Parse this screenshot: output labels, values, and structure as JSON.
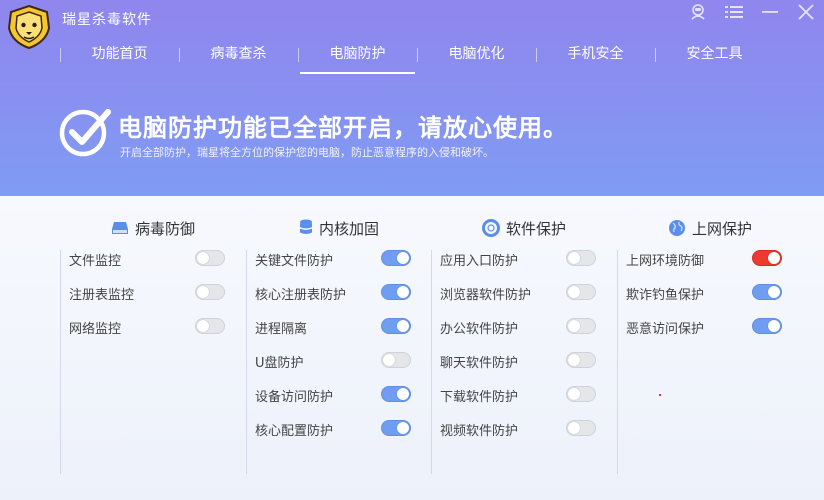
{
  "app": {
    "title": "瑞星杀毒软件",
    "logo_icon": "lion-logo-icon"
  },
  "window_controls": [
    {
      "name": "account-icon"
    },
    {
      "name": "menu-icon"
    },
    {
      "name": "minimize-icon"
    },
    {
      "name": "close-icon"
    }
  ],
  "nav": {
    "items": [
      {
        "label": "功能首页",
        "active": false
      },
      {
        "label": "病毒查杀",
        "active": false
      },
      {
        "label": "电脑防护",
        "active": true
      },
      {
        "label": "电脑优化",
        "active": false
      },
      {
        "label": "手机安全",
        "active": false
      },
      {
        "label": "安全工具",
        "active": false
      }
    ]
  },
  "banner": {
    "title": "电脑防护功能已全部开启，请放心使用。",
    "subtitle": "开启全部防护，瑞星将全方位的保护您的电脑，防止恶意程序的入侵和破坏。"
  },
  "colors": {
    "toggle_on": "#6f9ef0",
    "toggle_on_alert": "#ee3a2e",
    "toggle_off": "#e4e6ea",
    "header_top": "#8f86ee",
    "header_bottom": "#7e9cf3"
  },
  "sections": [
    {
      "title": "病毒防御",
      "icon": "hard-drive-icon",
      "items": [
        {
          "label": "文件监控",
          "on": false
        },
        {
          "label": "注册表监控",
          "on": false
        },
        {
          "label": "网络监控",
          "on": false
        }
      ]
    },
    {
      "title": "内核加固",
      "icon": "database-icon",
      "items": [
        {
          "label": "关键文件防护",
          "on": true
        },
        {
          "label": "核心注册表防护",
          "on": true
        },
        {
          "label": "进程隔离",
          "on": true
        },
        {
          "label": "U盘防护",
          "on": false
        },
        {
          "label": "设备访问防护",
          "on": true
        },
        {
          "label": "核心配置防护",
          "on": true
        }
      ]
    },
    {
      "title": "软件保护",
      "icon": "lifebuoy-icon",
      "items": [
        {
          "label": "应用入口防护",
          "on": false
        },
        {
          "label": "浏览器软件防护",
          "on": false
        },
        {
          "label": "办公软件防护",
          "on": false
        },
        {
          "label": "聊天软件防护",
          "on": false
        },
        {
          "label": "下载软件防护",
          "on": false
        },
        {
          "label": "视频软件防护",
          "on": false
        }
      ]
    },
    {
      "title": "上网保护",
      "icon": "globe-icon",
      "items": [
        {
          "label": "上网环境防御",
          "on": true,
          "alert": true
        },
        {
          "label": "欺诈钓鱼保护",
          "on": true
        },
        {
          "label": "恶意访问保护",
          "on": true
        }
      ]
    }
  ]
}
